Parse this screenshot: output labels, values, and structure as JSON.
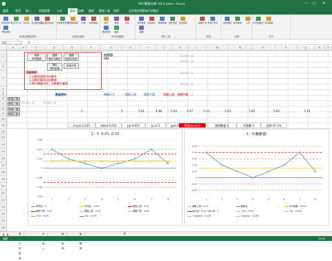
{
  "window": {
    "title": "SPC製程分析 V0.5.xlsm - Excel",
    "buttons": [
      "—",
      "▢",
      "✕"
    ]
  },
  "ribbon_tabs": [
    "檔案",
    "常用",
    "插入",
    "頁面配置",
    "公式",
    "資料",
    "校閱",
    "檢視",
    "開發人員",
    "說明",
    "告訴我您想要執行的動作"
  ],
  "active_ribbon_tab": "資料",
  "ribbon": {
    "groups": [
      {
        "label": "取得及轉換資料",
        "buttons": [
          "取得資料",
          "從文字/CSV",
          "從Web",
          "從表格/範圍",
          "最近使用的來源",
          "現有連線"
        ]
      },
      {
        "label": "查詢與連線",
        "buttons": [
          "全部重新整理",
          "查詢與連線",
          "內容",
          "編輯連結"
        ]
      },
      {
        "label": "排序與篩選",
        "buttons": [
          "排序",
          "篩選",
          "清除",
          "重新套用",
          "進階"
        ]
      },
      {
        "label": "資料工具",
        "buttons": [
          "資料剖析",
          "快速填入",
          "移除重複",
          "資料驗證",
          "合併彙算",
          "關聯"
        ]
      },
      {
        "label": "預測",
        "buttons": [
          "模擬分析",
          "預測工作表"
        ]
      },
      {
        "label": "大綱",
        "buttons": [
          "組成群組",
          "取消群組",
          "小計"
        ]
      },
      {
        "label": "文字",
        "buttons": [
          "文字轉語音",
          "停止朗讀"
        ]
      }
    ]
  },
  "formula_bar": {
    "name_box": "J10",
    "fx": "fx",
    "value": ""
  },
  "columns": [
    "A",
    "B",
    "C",
    "D",
    "E",
    "F",
    "G",
    "H",
    "I",
    "J",
    "K",
    "L",
    "M",
    "N",
    "O",
    "P",
    "Q",
    "R",
    "S",
    "T",
    "U"
  ],
  "rows": [
    "1",
    "2",
    "3",
    "4",
    "5",
    "6",
    "7",
    "8",
    "9",
    "10",
    "11",
    "12",
    "13",
    "14",
    "15",
    "16",
    "17",
    "18",
    "19",
    "20",
    "21",
    "22",
    "23",
    "24",
    "25",
    "26",
    "27",
    "28",
    "29"
  ],
  "controls": {
    "b1": "繪製\n所有圖表",
    "b2": "重建\n格式化條件",
    "b3": "重建\n數據分析區",
    "b4": "清除\n資料表格",
    "b5": "系統分析",
    "notes_title": "功能說明：",
    "notes": [
      "1.自動管理格式化條件",
      "2.自動計算與分析數據",
      "3.執行繪圖分析，自動產生圖表"
    ],
    "sample": "抽樣數\n8例",
    "grey_placeholder": "資料輸入區",
    "add_row": "新增(1筆)",
    "del_row": "刪除(1筆)"
  },
  "table_header": {
    "data": "數據資料",
    "std": "標稱尺寸",
    "usl": "管制上限",
    "lsl": "管制下限",
    "cu": "規格上限",
    "cl": "規格下限"
  },
  "table_values": {
    "n": "1",
    "v1": "5",
    "v2": "5.01",
    "v3": "4.98",
    "v4": "5.03",
    "v5": "4.97",
    "w1": "5.04",
    "w2": "5.02",
    "w3": "5.01",
    "w4": "5.02",
    "w5": "5.01"
  },
  "stats": {
    "mean": "mean:5.015",
    "stdev": "stdev:0.012",
    "pp": "pp:0.837",
    "pu": "pu:0.5",
    "ppk": "ppk:0.418",
    "grade": "等級(level)C",
    "defect": "實際數量:4",
    "ng": "不良數:1",
    "rate": "良率:87.5%"
  },
  "chart_data": [
    {
      "type": "line",
      "title": "1：5 -0.03 -0.03",
      "categories": [
        "1",
        "2",
        "3",
        "4",
        "5",
        "6",
        "7",
        "8"
      ],
      "series": [
        {
          "name": "標準值",
          "values": [
            5,
            5,
            5,
            5,
            5,
            5,
            5,
            5
          ]
        },
        {
          "name": "數值",
          "values": [
            5.04,
            5.02,
            5.01,
            5.0,
            5.01,
            5.02,
            5.04,
            5.01
          ]
        },
        {
          "name": "平均值",
          "values": [
            5.015,
            5.015,
            5.015,
            5.015,
            5.015,
            5.015,
            5.015,
            5.015
          ]
        }
      ],
      "ylim": [
        4.94,
        5.06
      ],
      "yticks": [
        "5.06",
        "5.04",
        "5.02",
        "5",
        "4.98",
        "4.96",
        "4.94"
      ],
      "legend": [
        "標準值：5",
        "平均值：5.015",
        "管制上限：5.03",
        "管制下限：4.97",
        "規格上限：5.04",
        "規格下限：4.96",
        "+3σ：5.051",
        "-3σ：4.979"
      ]
    },
    {
      "type": "line",
      "title": "1：5(偏差值)",
      "categories": [
        "1",
        "2",
        "3",
        "4",
        "5",
        "6",
        "7",
        "8"
      ],
      "series": [
        {
          "name": "偏差值",
          "values": [
            0.04,
            0.02,
            0.01,
            0,
            0.01,
            0.02,
            0.04,
            0.01
          ]
        }
      ],
      "ylim": [
        -0.03,
        0.06
      ],
      "yticks": [
        "0.05",
        "0.04",
        "0.03",
        "0.02",
        "0.01",
        "0",
        "-0.01",
        "-0.02"
      ],
      "legend": [
        "偏差上限：0.03",
        "偏差值",
        "平均偏差：0.015",
        "最大值：0.04 / 最小值：0",
        "+3σ：0.051",
        "-3σ：-0.021",
        "+2sigma：0.039",
        "-2sigma：-0.009"
      ]
    }
  ],
  "sheet_tabs": [
    "數據分析頁面",
    "數值輸入",
    "使用說明",
    "版本履歷"
  ],
  "active_sheet": "數值輸入",
  "status": {
    "left": "就緒",
    "zoom": "100%"
  }
}
